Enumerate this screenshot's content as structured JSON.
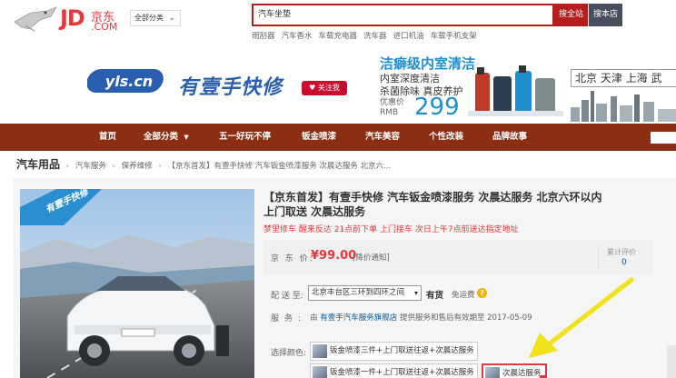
{
  "header": {
    "logo_text": "JD",
    "logo_cn": "京东",
    "logo_com": ".COM",
    "category_button": "全部分类",
    "search_value": "汽车坐垫",
    "search_all_btn": "搜全站",
    "search_shop_btn": "搜本店",
    "hotwords": [
      "雨刮器",
      "汽车香水",
      "车载充电器",
      "洗车器",
      "进口机油",
      "车载手机支架"
    ]
  },
  "banner": {
    "brand_logo": "yls.cn",
    "brand_name": "有壹手快修",
    "follow_button": "关注我",
    "promo_title": "洁癖级内室清洁",
    "promo_line1": "内室深度清洁",
    "promo_line2": "杀菌除味 真皮养护",
    "price_label_1": "优惠价",
    "price_label_2": "RMB",
    "price": "299",
    "cities": "北京 天津 上海 武"
  },
  "nav": {
    "items": [
      "首页",
      "全部分类",
      "五一好玩不停",
      "钣金喷漆",
      "汽车美容",
      "个性改装",
      "品牌故事"
    ],
    "dropdown_mark": "▼"
  },
  "breadcrumb": {
    "root": "汽车用品",
    "items": [
      "汽车服务",
      "保养维修",
      "【京东首发】有壹手快修 汽车钣金喷漆服务 次晨达服务 北京六..."
    ]
  },
  "product": {
    "badge_text": "有壹手快修",
    "title": "【京东首发】有壹手快修 汽车钣金喷漆服务 次晨达服务 北京六环以内上门取送 次晨达服务",
    "subtitle": "梦里修车 醒来反达 21点前下单 上门接车 次日上午7点前送达指定地址",
    "price_label": "京 东 价:",
    "price_value": "¥99.00",
    "price_notify": "[降价通知]",
    "review_label": "累计评价",
    "review_count": "0",
    "ship_label": "配 送 至:",
    "ship_value": "北京丰台区三环到四环之间",
    "stock": "有货",
    "free_ship": "免运费",
    "service_label": "服务:",
    "service_prefix": "由",
    "service_shop": "有壹手汽车服务旗舰店",
    "service_suffix": "提供服务和售后有效期至 2017-05-09",
    "color_label": "选择颜色:",
    "options": [
      "钣金喷漆三件+上门取送往返+次晨达服务",
      "钣金喷漆一件+上门取送往返+次晨达服务",
      "次晨达服务"
    ]
  },
  "colors": {
    "jd_red": "#e4393c",
    "nav_brown": "#8b2e14",
    "search_red": "#b61d1d",
    "link_blue": "#005aa0",
    "arrow_yellow": "#f2e21a"
  }
}
